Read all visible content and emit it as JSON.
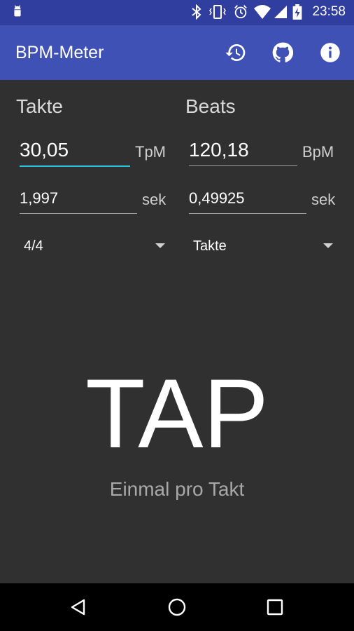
{
  "status_bar": {
    "time": "23:58",
    "icons": [
      "android-debug-icon",
      "bluetooth-icon",
      "vibrate-icon",
      "alarm-icon",
      "wifi-icon",
      "cell-signal-icon",
      "battery-charging-icon"
    ]
  },
  "toolbar": {
    "title": "BPM-Meter",
    "actions": [
      "history-icon",
      "github-icon",
      "info-icon"
    ]
  },
  "takte": {
    "heading": "Takte",
    "rate_value": "30,05",
    "rate_unit": "TpM",
    "duration_value": "1,997",
    "duration_unit": "sek",
    "time_signature": "4/4"
  },
  "beats": {
    "heading": "Beats",
    "rate_value": "120,18",
    "rate_unit": "BpM",
    "duration_value": "0,49925",
    "duration_unit": "sek",
    "mode": "Takte"
  },
  "tap": {
    "label": "TAP",
    "hint": "Einmal pro Takt"
  },
  "colors": {
    "status_bar": "#303f9f",
    "toolbar": "#3f51b5",
    "background": "#303030",
    "accent": "#26c6da"
  }
}
